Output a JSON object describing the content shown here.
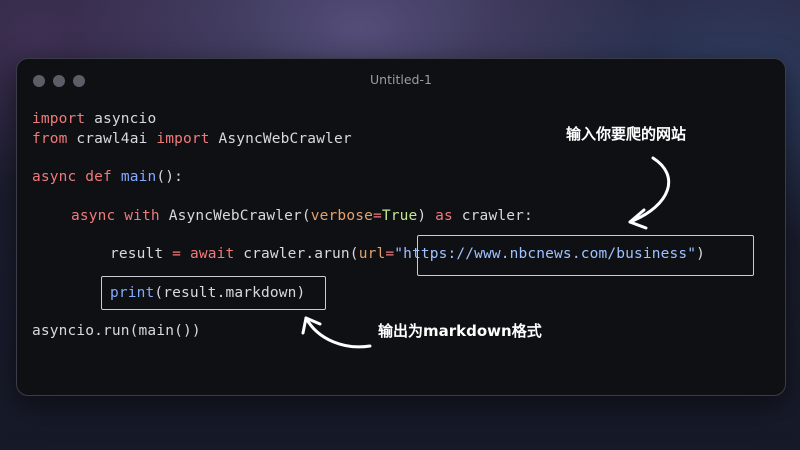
{
  "window": {
    "title": "Untitled-1"
  },
  "code": {
    "line1": {
      "kw": "import",
      "rest": " asyncio"
    },
    "line2": {
      "kw1": "from",
      "mid": " crawl4ai ",
      "kw2": "import",
      "rest": " AsyncWebCrawler"
    },
    "line3": {
      "kw1": "async",
      "sp1": " ",
      "kw2": "def",
      "sp2": " ",
      "fn": "main",
      "rest": "():"
    },
    "line4": {
      "kw1": "async",
      "sp1": " ",
      "kw2": "with",
      "mid": " AsyncWebCrawler(",
      "param": "verbose",
      "eq": "=",
      "val": "True",
      "close": ") ",
      "kw3": "as",
      "rest": " crawler:"
    },
    "line5": {
      "pre": "result ",
      "eq": "=",
      "sp": " ",
      "kw": "await",
      "mid": " crawler.arun(",
      "param": "url",
      "eq2": "=",
      "url": "\"https://www.nbcnews.com/business\"",
      "close": ")"
    },
    "line6": {
      "fn": "print",
      "rest": "(result.markdown)"
    },
    "line7": {
      "text": "asyncio.run(main())"
    }
  },
  "annotations": {
    "url_note": "输入你要爬的网站",
    "markdown_note": "输出为markdown格式"
  },
  "colors": {
    "keyword": "#f07a7a",
    "function": "#82aaff",
    "parameter": "#e5a26b",
    "boolean": "#c3e88d",
    "string": "#9fc2ff",
    "text": "#d7d9de"
  }
}
